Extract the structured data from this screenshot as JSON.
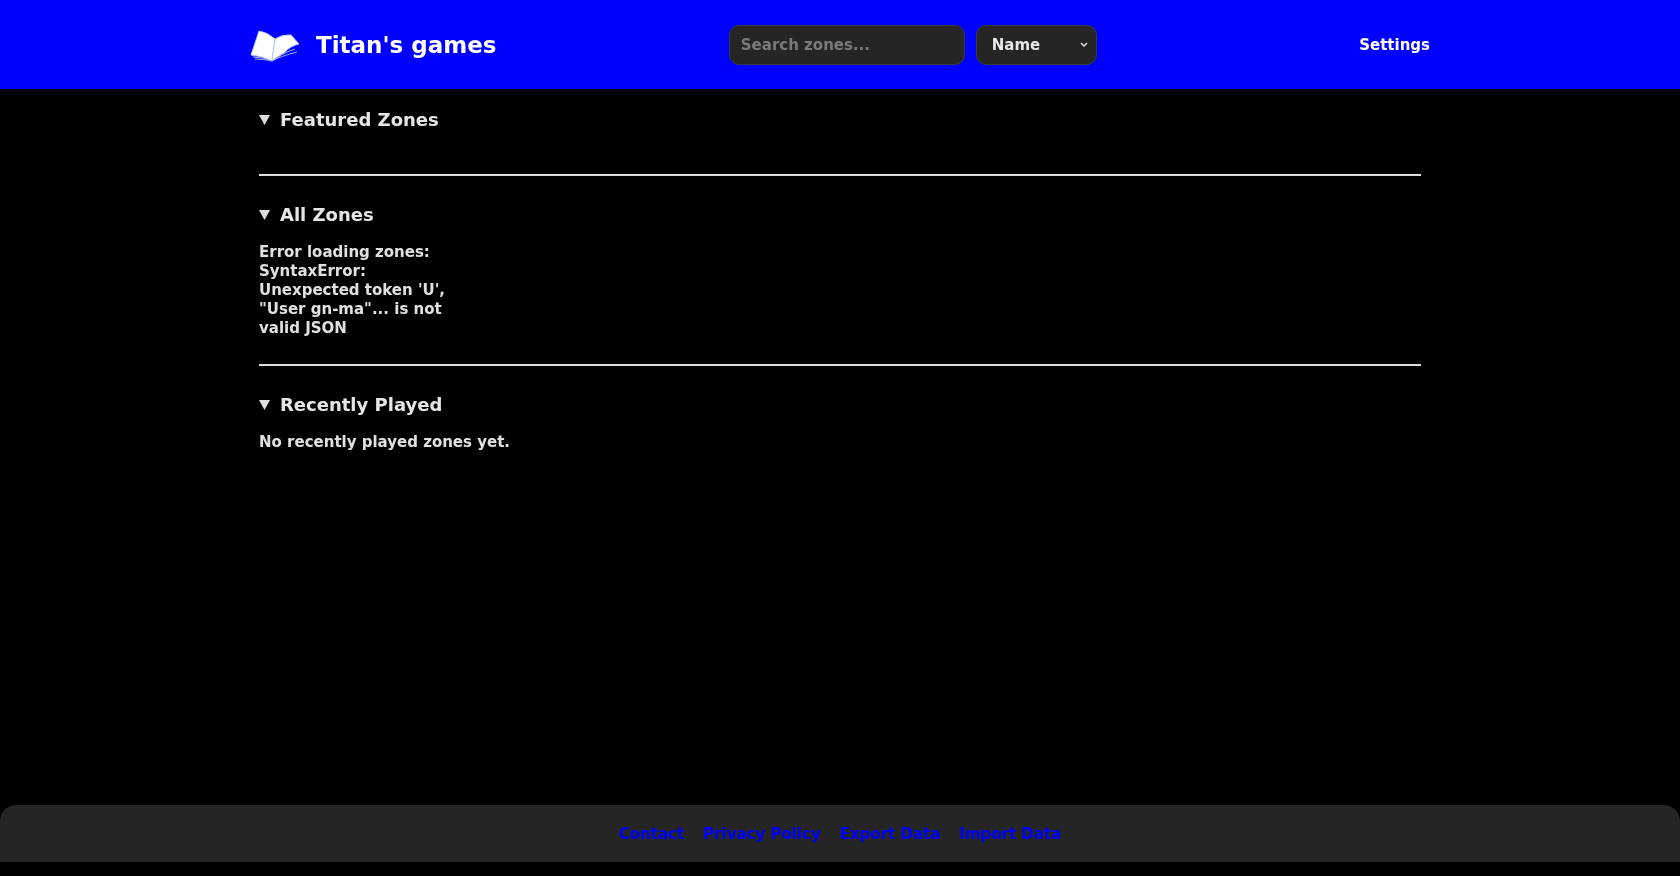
{
  "header": {
    "title": "Titan's games",
    "search": {
      "placeholder": "Search zones..."
    },
    "sort": {
      "value": "Name"
    },
    "settings": "Settings"
  },
  "sections": [
    {
      "title": "Featured Zones",
      "expanded": true
    },
    {
      "title": "All Zones",
      "expanded": true,
      "message": {
        "kind": "error",
        "text": "Error loading zones: SyntaxError: Unexpected token 'U', \"User gn-ma\"... is not valid JSON"
      }
    },
    {
      "title": "Recently Played",
      "expanded": true,
      "message": {
        "kind": "empty",
        "text": "No recently played zones yet."
      }
    }
  ],
  "footer": {
    "links": [
      "Contact",
      "Privacy Policy",
      "Export Data",
      "Import Data"
    ]
  }
}
